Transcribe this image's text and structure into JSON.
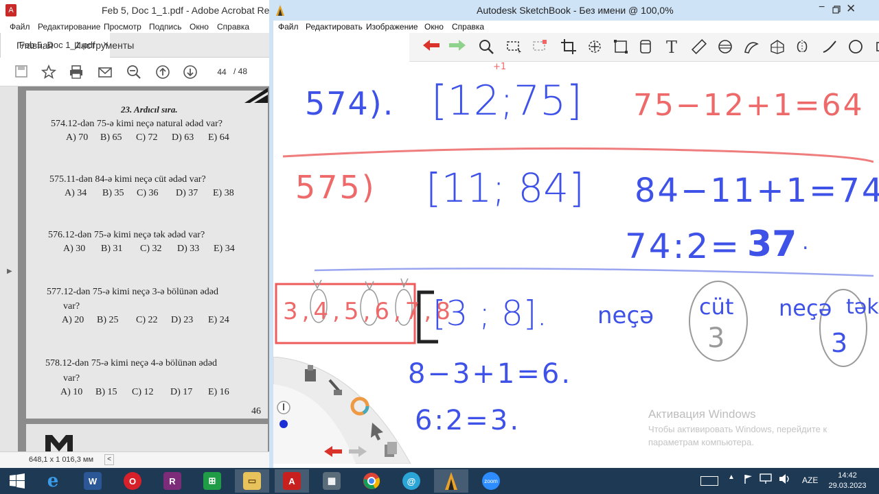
{
  "acrobat": {
    "title": "Feb 5, Doc 1_1.pdf - Adobe Acrobat Re",
    "menu": [
      "Файл",
      "Редактирование",
      "Просмотр",
      "Подпись",
      "Окно",
      "Справка"
    ],
    "tabs": {
      "home": "Главная",
      "tools": "Инструменты",
      "doc": "Feb 5, Doc 1_1.pdf",
      "close": "×"
    },
    "page_current": "44",
    "page_total": "/ 48",
    "status_size": "648,1 x 1 016,3 мм",
    "status_arrow": "<",
    "page": {
      "section_title": "23. Ardıcıl sıra.",
      "footer_number": "46",
      "questions": [
        {
          "text": "574.12-dən 75-ə kimi neçə natural ədəd var?",
          "cont": "",
          "options": [
            "A) 70",
            "B) 65",
            "C) 72",
            "D) 63",
            "E) 64"
          ]
        },
        {
          "text": "575.11-dən 84-ə kimi neçə cüt ədəd var?",
          "cont": "",
          "options": [
            "A) 34",
            "B) 35",
            "C) 36",
            "D) 37",
            "E) 38"
          ]
        },
        {
          "text": "576.12-dən 75-ə kimi neçə tək ədəd var?",
          "cont": "",
          "options": [
            "A) 30",
            "B) 31",
            "C) 32",
            "D) 33",
            "E) 34"
          ]
        },
        {
          "text": "577.12-dən 75-ə kimi neçə 3-ə bölünən ədəd",
          "cont": "var?",
          "options": [
            "A) 20",
            "B) 25",
            "C) 22",
            "D) 23",
            "E) 24"
          ]
        },
        {
          "text": "578.12-dən 75-ə kimi neçə 4-ə bölünən ədəd",
          "cont": "var?",
          "options": [
            "A) 10",
            "B) 15",
            "C) 12",
            "D) 17",
            "E) 16"
          ]
        }
      ]
    }
  },
  "sketchbook": {
    "title": "Autodesk SketchBook - Без имени @ 100,0%",
    "menu": [
      "Файл",
      "Редактировать",
      "Изображение",
      "Окно",
      "Справка"
    ],
    "handwriting": {
      "r574_label": "574).",
      "r574_interval": "[12;75]",
      "r574_tiny": "+1",
      "r574_formula": "75−12+1=64",
      "r575_label": "575)",
      "r575_interval": "[11; 84]",
      "r575_formula": "84−11+1=74.",
      "r575_div": "74:2=",
      "r575_result": "37",
      "r575_dot": ".",
      "seq": "3,4,5,6,7,8",
      "interval3": "[3 ; 8].",
      "word1": "neçə",
      "word2": "cüt",
      "word3": "neçə",
      "word4": "tək",
      "circ1": "3",
      "circ2": "3",
      "f1": "8−3+1=6.",
      "f2": "6:2=3."
    }
  },
  "activation": {
    "title": "Активация Windows",
    "text": "Чтобы активировать Windows, перейдите к параметрам компьютера."
  },
  "taskbar": {
    "lang": "AZE",
    "time": "14:42",
    "date": "29.03.2023",
    "zoom_label": "zoom"
  },
  "colors": {
    "ink_blue": "#3f52e8",
    "ink_red": "#ee6a6a",
    "taskbar": "#1d3954"
  }
}
